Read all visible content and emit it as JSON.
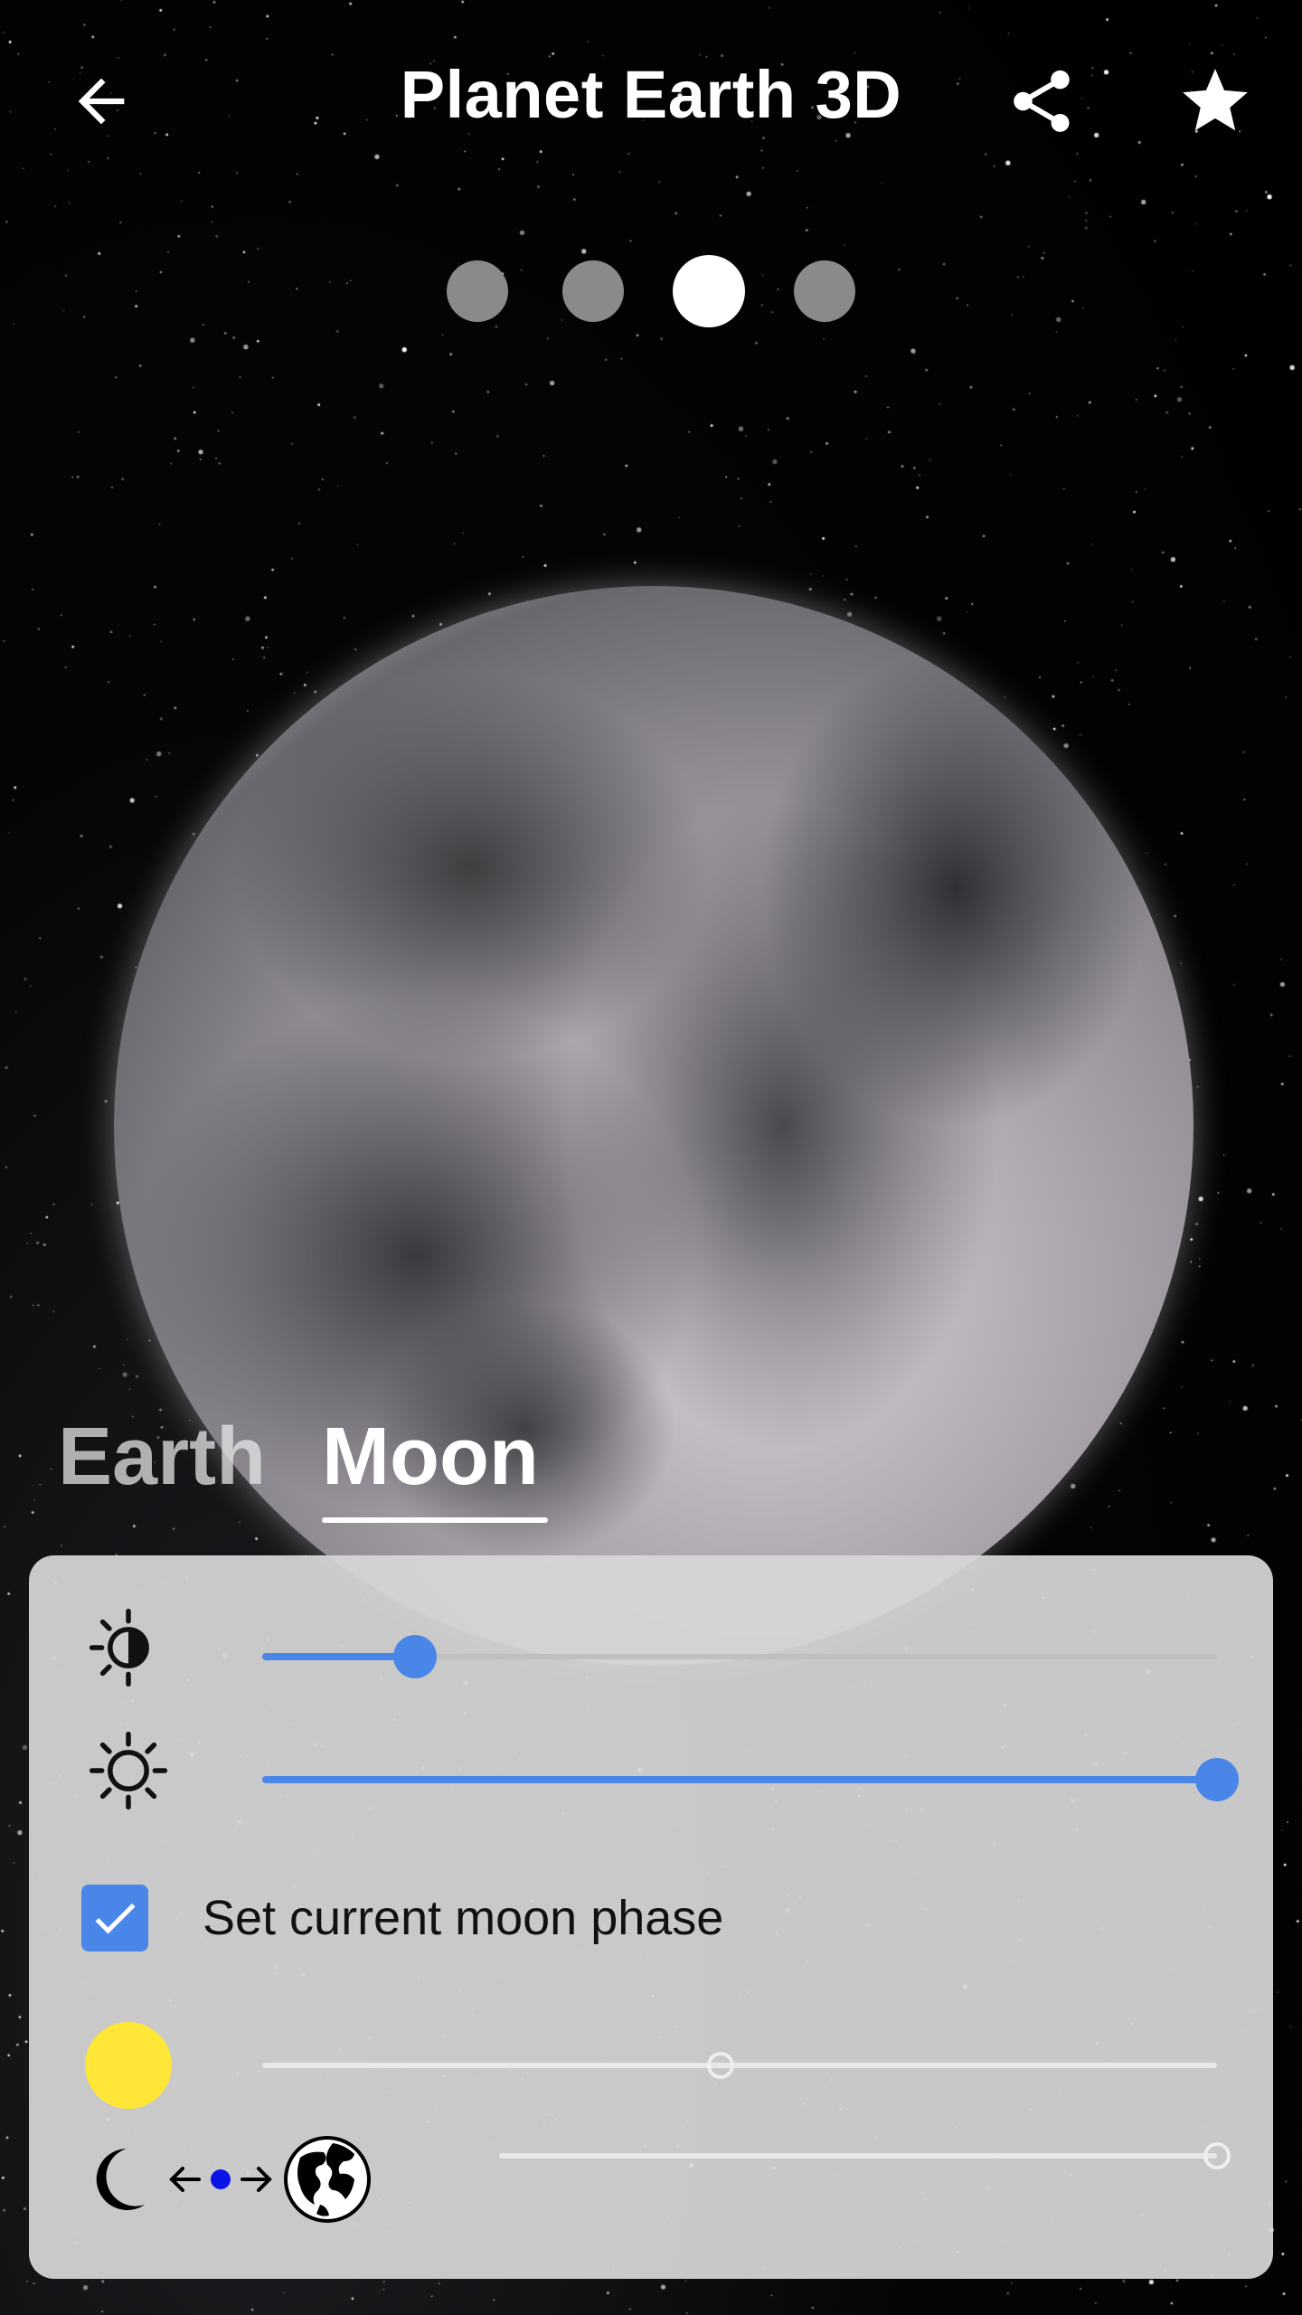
{
  "header": {
    "title": "Planet Earth 3D",
    "back_icon": "arrow-left-icon",
    "share_icon": "share-icon",
    "favorite_icon": "star-icon"
  },
  "pager": {
    "count": 4,
    "active_index": 2
  },
  "tabs": [
    {
      "label": "Earth",
      "active": false
    },
    {
      "label": "Moon",
      "active": true
    }
  ],
  "controls": {
    "contrast_slider": {
      "icon": "contrast-icon",
      "value": 0.16
    },
    "brightness_slider": {
      "icon": "brightness-icon",
      "value": 1.0
    },
    "moon_phase_checkbox": {
      "label": "Set current moon phase",
      "checked": true
    },
    "sun_slider": {
      "icon": "sun-icon",
      "value": 0.48,
      "enabled": false,
      "color": "#ffe637"
    },
    "distance_slider": {
      "icons": [
        "crescent-moon-icon",
        "arrow-left-icon",
        "dot-icon",
        "arrow-right-icon",
        "globe-icon"
      ],
      "value": 1.0,
      "enabled": false
    }
  },
  "colors": {
    "accent": "#4a86e8",
    "panel": "#d7d7d7"
  }
}
